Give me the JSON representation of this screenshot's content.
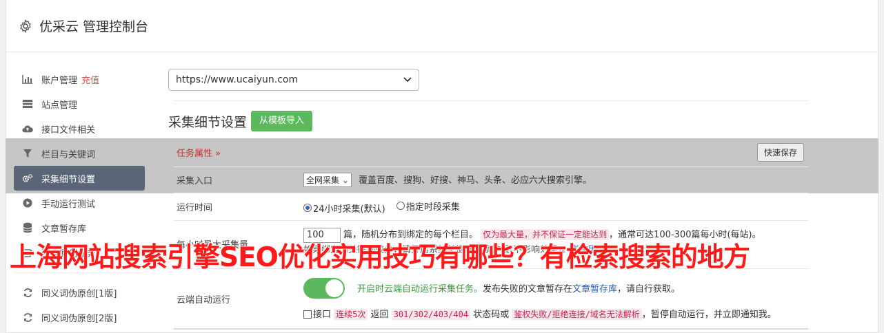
{
  "header": {
    "title": "优采云 管理控制台",
    "icon": "gear-icon"
  },
  "sidebar": {
    "items": [
      {
        "label": "账户管理",
        "extra": "充值",
        "icon": "bar-chart-icon"
      },
      {
        "label": "站点管理",
        "icon": "server-icon"
      },
      {
        "label": "接口文件相关",
        "icon": "cloud-upload-icon"
      },
      {
        "label": "栏目与关键词",
        "icon": "filter-icon"
      },
      {
        "label": "采集细节设置",
        "icon": "cogs-icon",
        "active": true
      },
      {
        "label": "手动运行测试",
        "icon": "play-circle-icon"
      },
      {
        "label": "文章暂存库",
        "icon": "database-icon"
      },
      {
        "label": "深度原创任务",
        "icon": "edit-icon"
      },
      {
        "label": "同义词伪原创[1版]",
        "icon": "refresh-icon"
      },
      {
        "label": "同义词伪原创[2版]",
        "icon": "refresh-icon"
      }
    ]
  },
  "main": {
    "site_select": "https://www.ucaiyun.com",
    "section_title": "采集细节设置",
    "import_button": "从模板导入",
    "task_attr": "任务属性",
    "save_button": "快速保存",
    "rows": {
      "entry": {
        "label": "采集入口",
        "select": "全网采集",
        "desc": "覆盖百度、搜狗、好搜、神马、头条、必应六大搜索引擎。"
      },
      "runtime": {
        "label": "运行时间",
        "opt1": "24小时采集(默认)",
        "opt2": "指定时段采集"
      },
      "limit": {
        "label": "每小时最大采集量",
        "value": "100",
        "text1": "篇，随机分布到绑定的每个栏目。",
        "tag1": "仅为最大量，并不保证一定能达到",
        "text2": "，通常可达100-300篇每小时(每站)。",
        "line2": "如果绑定的关键词较少，请开启系统关键词搜索扩展(不影响效果)。",
        "link": "影响因素"
      },
      "cloud": {
        "label": "云端自动运行",
        "green": "开启时云端自动运行采集任务。",
        "text1": "发布失败的文章暂存在",
        "link": "文章暂存库",
        "text2": "，请自行获取。",
        "cb_label": "接口",
        "tag1": "连续5次",
        "text3": "返回",
        "tag2": "301/302/403/404",
        "text4": "状态码或",
        "tag3": "鉴权失败/拒绝连接/域名无法解析",
        "text5": "，暂停自动运行，并立即通知我。"
      }
    }
  },
  "overlay": {
    "title": "上海网站搜索引擎SEO优化实用技巧有哪些？有检索搜索的地方"
  },
  "colors": {
    "accent_green": "#5cb85c",
    "active_nav": "#5a6577",
    "overlay_red": "#ff1a1a"
  }
}
